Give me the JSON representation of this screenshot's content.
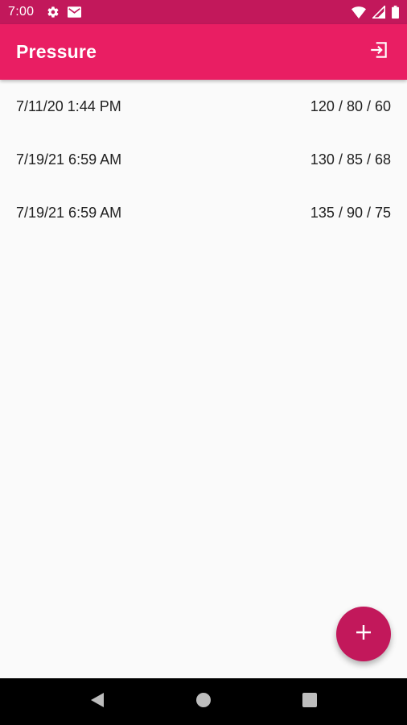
{
  "status_bar": {
    "time": "7:00",
    "left_icons": [
      "settings-icon",
      "mail-icon"
    ],
    "right_icons": [
      "wifi-icon",
      "signal-icon",
      "battery-icon"
    ]
  },
  "app_bar": {
    "title": "Pressure",
    "action_icon": "login-icon"
  },
  "readings": [
    {
      "date": "7/11/20 1:44 PM",
      "value": "120 / 80 / 60"
    },
    {
      "date": "7/19/21 6:59 AM",
      "value": "130 / 85 / 68"
    },
    {
      "date": "7/19/21 6:59 AM",
      "value": "135 / 90 / 75"
    }
  ],
  "fab": {
    "icon": "add-icon"
  },
  "nav_bar": {
    "buttons": [
      "back-icon",
      "home-icon",
      "recents-icon"
    ]
  },
  "colors": {
    "status_bar": "#c2185b",
    "app_bar": "#e91e63",
    "fab": "#c2185b",
    "background": "#fafafa",
    "text": "#212121"
  }
}
